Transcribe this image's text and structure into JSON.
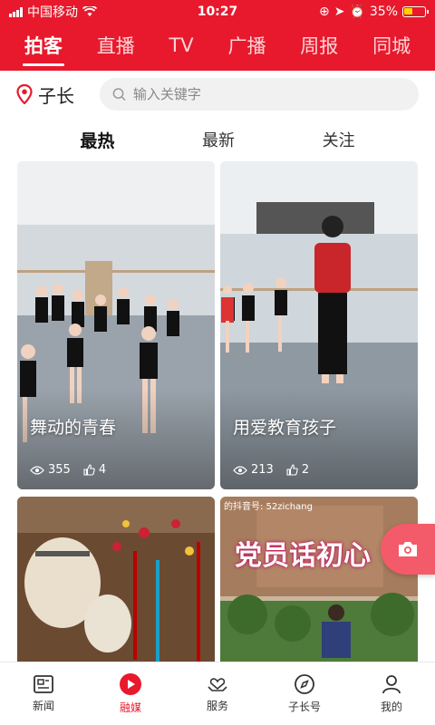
{
  "status": {
    "carrier": "中国移动",
    "time": "10:27",
    "battery": "35%"
  },
  "top_tabs": [
    {
      "label": "拍客",
      "active": true
    },
    {
      "label": "直播"
    },
    {
      "label": "TV"
    },
    {
      "label": "广播"
    },
    {
      "label": "周报"
    },
    {
      "label": "同城"
    }
  ],
  "location": {
    "label": "子长"
  },
  "search": {
    "placeholder": "输入关键字"
  },
  "sub_tabs": [
    {
      "label": "最热",
      "active": true
    },
    {
      "label": "最新"
    },
    {
      "label": "关注"
    }
  ],
  "cards": [
    {
      "title": "舞动的青春",
      "views": "355",
      "likes": "4"
    },
    {
      "title": "用爱教育孩子",
      "views": "213",
      "likes": "2"
    },
    {
      "title": ""
    },
    {
      "overlay_text": "党员话初心",
      "watermark": "的抖音号: 52zichang"
    }
  ],
  "bottom_nav": [
    {
      "label": "新闻",
      "icon": "news-icon"
    },
    {
      "label": "融媒",
      "icon": "play-icon",
      "active": true
    },
    {
      "label": "服务",
      "icon": "service-heart-icon"
    },
    {
      "label": "子长号",
      "icon": "compass-icon"
    },
    {
      "label": "我的",
      "icon": "user-icon"
    }
  ],
  "colors": {
    "brand": "#e8192c"
  }
}
